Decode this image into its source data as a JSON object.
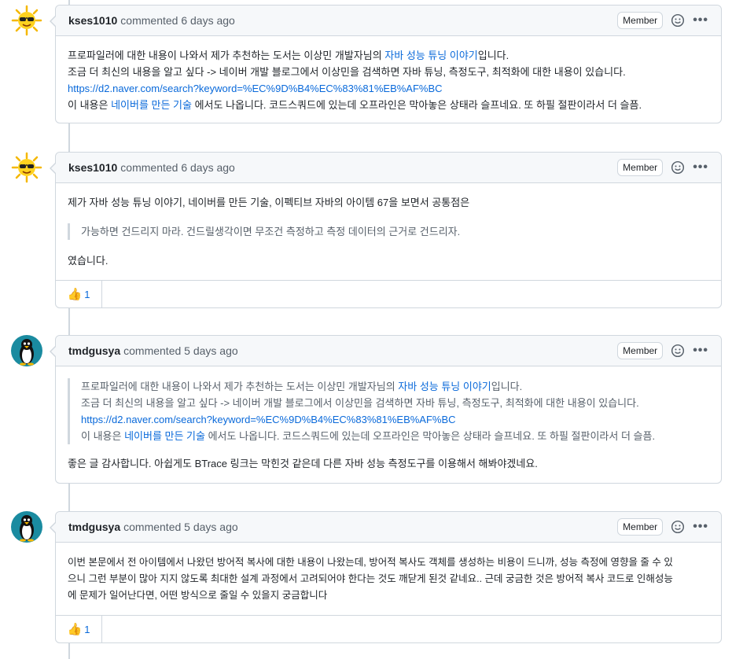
{
  "comments": [
    {
      "author": "kses1010",
      "meta": "commented 6 days ago",
      "badge": "Member",
      "line1_pre": "프로파일러에 대한 내용이 나와서 제가 추천하는 도서는 이상민 개발자님의 ",
      "line1_link": "자바 성능 튜닝 이야기",
      "line1_post": "입니다.",
      "line2": "조금 더 최신의 내용을 알고 싶다 -> 네이버 개발 블로그에서 이상민을 검색하면 자바 튜닝, 측정도구, 최적화에 대한 내용이 있습니다.",
      "line3_link": "https://d2.naver.com/search?keyword=%EC%9D%B4%EC%83%81%EB%AF%BC",
      "line4_pre": "이 내용은 ",
      "line4_link": "네이버를 만든 기술",
      "line4_post": " 에서도 나옵니다. 코드스쿼드에 있는데 오프라인은 막아놓은 상태라 슬프네요. 또 하필 절판이라서 더 슬픔."
    },
    {
      "author": "kses1010",
      "meta": "commented 6 days ago",
      "badge": "Member",
      "line1": "제가 자바 성능 튜닝 이야기, 네이버를 만든 기술, 이펙티브 자바의 아이템 67을 보면서 공통점은",
      "quote": "가능하면 건드리지 마라. 건드릴생각이면 무조건 측정하고 측정 데이터의 근거로 건드리자.",
      "line2": "였습니다.",
      "reaction_emoji": "👍",
      "reaction_count": "1"
    },
    {
      "author": "tmdgusya",
      "meta": "commented 5 days ago",
      "badge": "Member",
      "q1_pre": "프로파일러에 대한 내용이 나와서 제가 추천하는 도서는 이상민 개발자님의 ",
      "q1_link": "자바 성능 튜닝 이야기",
      "q1_post": "입니다.",
      "q2": "조금 더 최신의 내용을 알고 싶다 -> 네이버 개발 블로그에서 이상민을 검색하면 자바 튜닝, 측정도구, 최적화에 대한 내용이 있습니다.",
      "q3_link": "https://d2.naver.com/search?keyword=%EC%9D%B4%EC%83%81%EB%AF%BC",
      "q4_pre": "이 내용은 ",
      "q4_link": "네이버를 만든 기술",
      "q4_post": " 에서도 나옵니다. 코드스쿼드에 있는데 오프라인은 막아놓은 상태라 슬프네요. 또 하필 절판이라서 더 슬픔.",
      "line1": "좋은 글 감사합니다. 아쉽게도 BTrace 링크는 막힌것 같은데 다른 자바 성능 측정도구를 이용해서 해봐야겠네요."
    },
    {
      "author": "tmdgusya",
      "meta": "commented 5 days ago",
      "badge": "Member",
      "line1": "이번 본문에서 전 아이템에서 나왔던 방어적 복사에 대한 내용이 나왔는데, 방어적 복사도 객체를 생성하는 비용이 드니까, 성능 측정에 영향을 줄 수 있",
      "line2": "으니 그런 부분이 많아 지지 않도록 최대한 설계 과정에서 고려되어야 한다는 것도 깨닫게 된것 같네요.. 근데 궁금한 것은 방어적 복사 코드로 인해성능",
      "line3": "에 문제가 일어난다면, 어떤 방식으로 줄일 수 있을지 궁금합니다",
      "reaction_emoji": "👍",
      "reaction_count": "1"
    }
  ]
}
